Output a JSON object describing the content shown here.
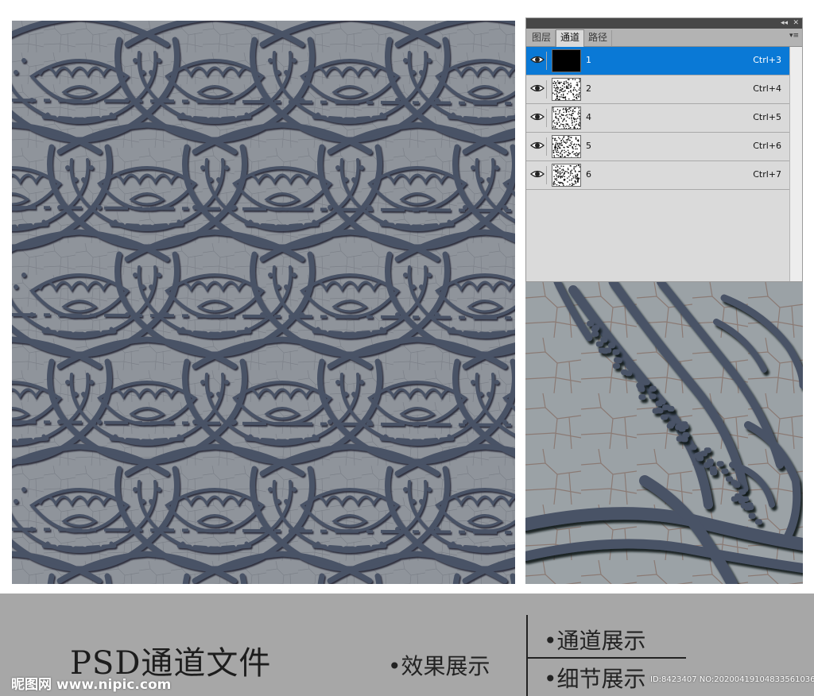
{
  "panel": {
    "tabs": [
      {
        "label": "图层",
        "active": false
      },
      {
        "label": "通道",
        "active": true
      },
      {
        "label": "路径",
        "active": false
      }
    ],
    "collapse_glyph": "◂◂",
    "close_glyph": "✕",
    "menu_glyph": "▾≡",
    "channels": [
      {
        "name": "1",
        "shortcut": "Ctrl+3",
        "selected": true,
        "thumb": "black"
      },
      {
        "name": "2",
        "shortcut": "Ctrl+4",
        "selected": false,
        "thumb": "noise"
      },
      {
        "name": "4",
        "shortcut": "Ctrl+5",
        "selected": false,
        "thumb": "noise"
      },
      {
        "name": "5",
        "shortcut": "Ctrl+6",
        "selected": false,
        "thumb": "noise"
      },
      {
        "name": "6",
        "shortcut": "Ctrl+7",
        "selected": false,
        "thumb": "noise"
      }
    ],
    "selected_color": "#0a79d6"
  },
  "caption": {
    "title": "PSD通道文件",
    "effect": "•效果展示",
    "channel": "•通道展示",
    "detail": "•细节展示"
  },
  "watermark": {
    "left": "昵图网 www.nipic.com",
    "right": "ID:8423407 NO:20200419104833561036"
  },
  "texture": {
    "base_color": "#8f949b",
    "relief_color": "#4a5266",
    "detail_base_color": "#9ba2a6"
  }
}
